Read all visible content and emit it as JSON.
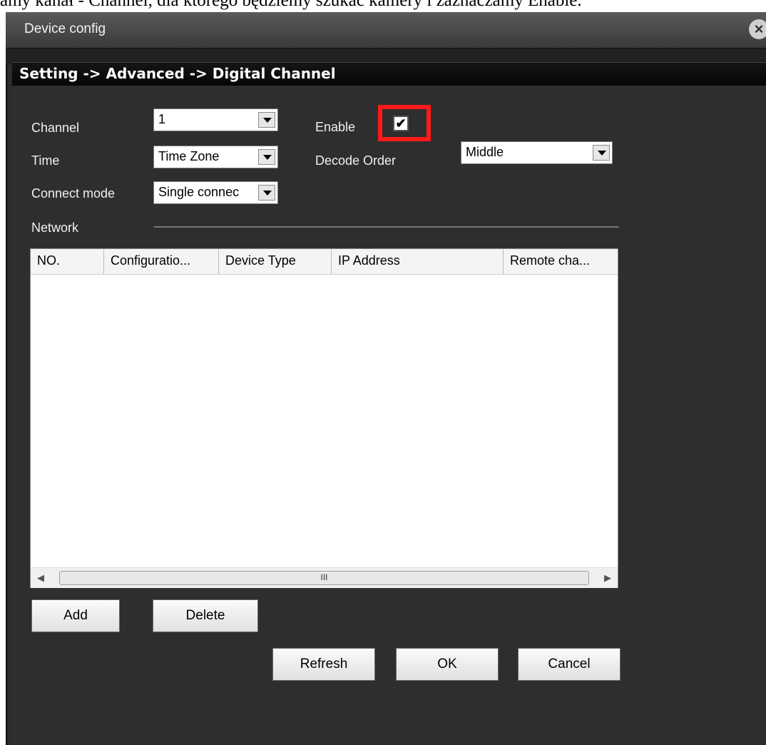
{
  "document_text": "amy kanał - Channel, dla którego będziemy szukać kamery i zaznaczamy Enable.",
  "window": {
    "title": "Device config",
    "close_glyph": "×",
    "breadcrumb": "Setting -> Advanced -> Digital Channel"
  },
  "form": {
    "channel_label": "Channel",
    "channel_value": "1",
    "time_label": "Time",
    "time_value": "Time Zone",
    "connect_mode_label": "Connect mode",
    "connect_mode_value": "Single connec",
    "enable_label": "Enable",
    "enable_checked": true,
    "enable_glyph": "✔",
    "decode_order_label": "Decode Order",
    "decode_order_value": "Middle",
    "network_label": "Network"
  },
  "table": {
    "columns": [
      "NO.",
      "Configuratio...",
      "Device Type",
      "IP Address",
      "Remote cha..."
    ],
    "rows": [],
    "scroll_left_glyph": "◀",
    "scroll_right_glyph": "▶",
    "scroll_thumb_grip": "III"
  },
  "buttons": {
    "add": "Add",
    "delete": "Delete",
    "refresh": "Refresh",
    "ok": "OK",
    "cancel": "Cancel"
  },
  "colors": {
    "window_bg": "#2c2c2c",
    "highlight_box": "#ff1a1a",
    "text_light": "#f0f0f0"
  },
  "icons": {
    "close": "close-icon",
    "dropdown": "chevron-down-icon",
    "checkbox": "check-icon"
  }
}
